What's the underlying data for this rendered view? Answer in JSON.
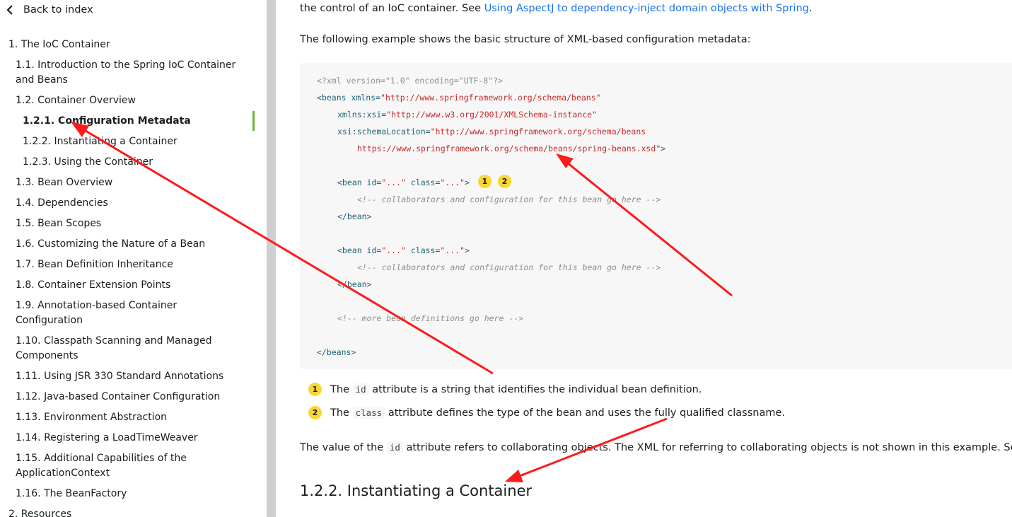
{
  "sidebar": {
    "back_label": "Back to index",
    "items": [
      {
        "label": "1. The IoC Container"
      },
      {
        "label": "1.1. Introduction to the Spring IoC Container",
        "label2": "and Beans"
      },
      {
        "label": "1.2. Container Overview"
      },
      {
        "label": "1.2.1. Configuration Metadata"
      },
      {
        "label": "1.2.2. Instantiating a Container"
      },
      {
        "label": "1.2.3. Using the Container"
      },
      {
        "label": "1.3. Bean Overview"
      },
      {
        "label": "1.4. Dependencies"
      },
      {
        "label": "1.5. Bean Scopes"
      },
      {
        "label": "1.6. Customizing the Nature of a Bean"
      },
      {
        "label": "1.7. Bean Definition Inheritance"
      },
      {
        "label": "1.8. Container Extension Points"
      },
      {
        "label": "1.9. Annotation-based Container",
        "label2": "Configuration"
      },
      {
        "label": "1.10. Classpath Scanning and Managed",
        "label2": "Components"
      },
      {
        "label": "1.11. Using JSR 330 Standard Annotations"
      },
      {
        "label": "1.12. Java-based Container Configuration"
      },
      {
        "label": "1.13. Environment Abstraction"
      },
      {
        "label": "1.14. Registering a LoadTimeWeaver"
      },
      {
        "label": "1.15. Additional Capabilities of the",
        "label2": "ApplicationContext"
      },
      {
        "label": "1.16. The BeanFactory"
      },
      {
        "label": "2. Resources"
      }
    ]
  },
  "content": {
    "intro_text": "the control of an IoC container. See ",
    "intro_link": "Using AspectJ to dependency-inject domain objects with Spring",
    "intro_end": ".",
    "example_text": "The following example shows the basic structure of XML-based configuration metadata:",
    "code": {
      "l1": "<?xml version=\"1.0\" encoding=\"UTF-8\"?>",
      "l2_tag": "<beans xmlns=",
      "l2_str": "\"http://www.springframework.org/schema/beans\"",
      "l3_tag": "xmlns:xsi=",
      "l3_str": "\"http://www.w3.org/2001/XMLSchema-instance\"",
      "l4_tag": "xsi:schemaLocation=",
      "l4_str": "\"http://www.springframework.org/schema/beans",
      "l5_str": "https://www.springframework.org/schema/beans/spring-beans.xsd\"",
      "l5_tag": ">",
      "bean_open_a": "<bean id=",
      "bean_id_val": "\"...\"",
      "bean_open_b": " class=",
      "bean_class_val": "\"...\"",
      "bean_open_c": ">",
      "comment_collab": "<!-- collaborators and configuration for this bean go here -->",
      "bean_close": "</bean>",
      "comment_more": "<!-- more bean definitions go here -->",
      "beans_close": "</beans>",
      "callout1": "1",
      "callout2": "2"
    },
    "colist": [
      {
        "num": "1",
        "pre": "The ",
        "code": "id",
        "post": " attribute is a string that identifies the individual bean definition."
      },
      {
        "num": "2",
        "pre": "The ",
        "code": "class",
        "post": " attribute defines the type of the bean and uses the fully qualified classname."
      }
    ],
    "value_pre": "The value of the ",
    "value_code": "id",
    "value_post": " attribute refers to collaborating objects. The XML for referring to collaborating objects is not shown in this example. Se",
    "heading": "1.2.2. Instantiating a Container"
  },
  "colors": {
    "accent_green": "#6db33f",
    "link_blue": "#1a73e8",
    "callout_yellow": "#f9d634",
    "annotation_red": "#ff1a1a"
  }
}
